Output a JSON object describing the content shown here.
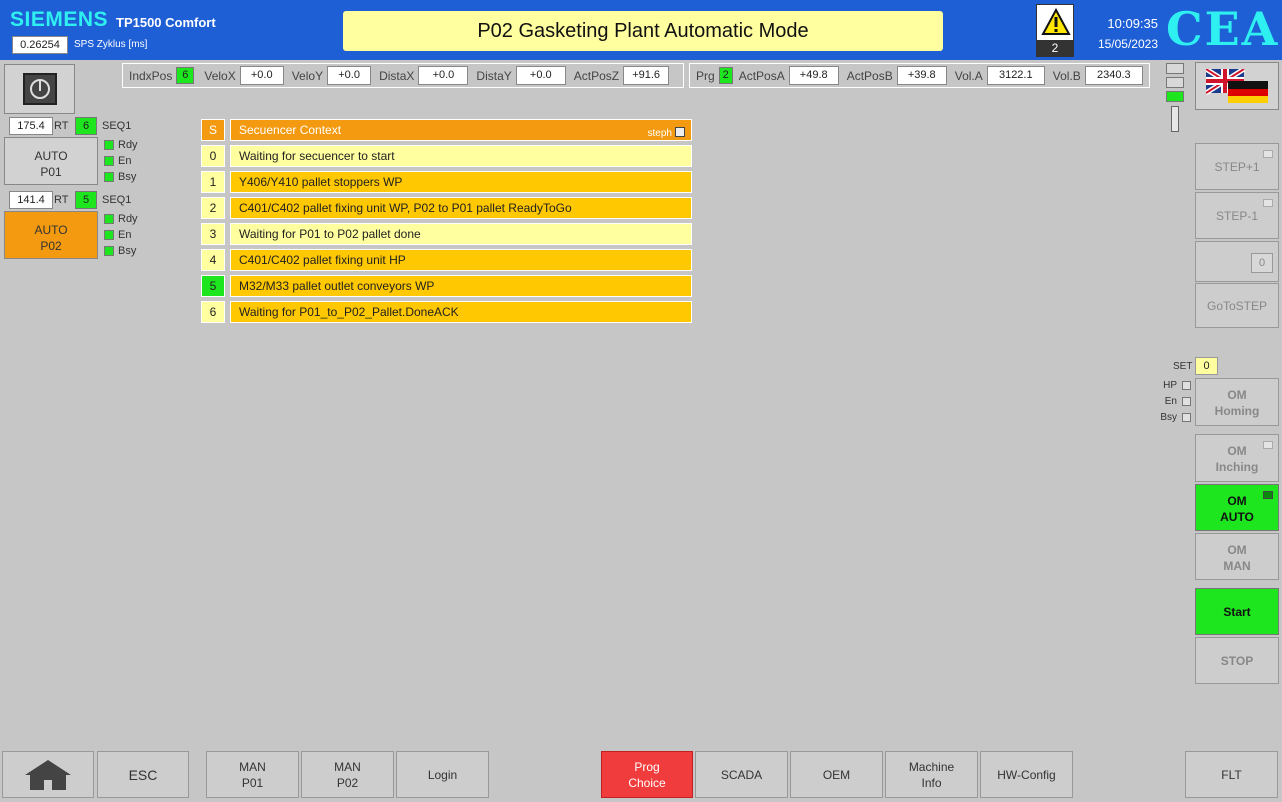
{
  "header": {
    "brand": "SIEMENS",
    "model": "TP1500 Comfort",
    "cycle_value": "0.26254",
    "cycle_label": "SPS Zyklus [ms]",
    "title": "P02 Gasketing Plant Automatic Mode",
    "alarm_count": "2",
    "time": "10:09:35",
    "date": "15/05/2023",
    "logo": "CEA"
  },
  "axis_left": {
    "indxpos_label": "IndxPos",
    "indxpos_value": "6",
    "velox_label": "VeloX",
    "velox_value": "+0.0",
    "veloy_label": "VeloY",
    "veloy_value": "+0.0",
    "distax_label": "DistaX",
    "distax_value": "+0.0",
    "distay_label": "DistaY",
    "distay_value": "+0.0",
    "actposz_label": "ActPosZ",
    "actposz_value": "+91.6"
  },
  "axis_right": {
    "prg_label": "Prg",
    "prg_value": "2",
    "actposa_label": "ActPosA",
    "actposa_value": "+49.8",
    "actposb_label": "ActPosB",
    "actposb_value": "+39.8",
    "vola_label": "Vol.A",
    "vola_value": "3122.1",
    "volb_label": "Vol.B",
    "volb_value": "2340.3"
  },
  "p01": {
    "rt_value": "175.4",
    "rt_label": "RT",
    "rt_num": "6",
    "seq_label": "SEQ1",
    "btn_line1": "AUTO",
    "btn_line2": "P01",
    "rdy": "Rdy",
    "en": "En",
    "bsy": "Bsy"
  },
  "p02": {
    "rt_value": "141.4",
    "rt_label": "RT",
    "rt_num": "5",
    "seq_label": "SEQ1",
    "btn_line1": "AUTO",
    "btn_line2": "P02",
    "rdy": "Rdy",
    "en": "En",
    "bsy": "Bsy"
  },
  "sequencer": {
    "header_num": "S",
    "header_text": "Secuencer Context",
    "steph_label": "steph",
    "steps": [
      {
        "num": "0",
        "text": "Waiting for secuencer to start"
      },
      {
        "num": "1",
        "text": "Y406/Y410 pallet stoppers WP"
      },
      {
        "num": "2",
        "text": "C401/C402 pallet fixing unit WP, P02 to P01 pallet ReadyToGo"
      },
      {
        "num": "3",
        "text": "Waiting for P01 to P02 pallet done"
      },
      {
        "num": "4",
        "text": "C401/C402 pallet fixing unit HP"
      },
      {
        "num": "5",
        "text": "M32/M33 pallet outlet conveyors WP"
      },
      {
        "num": "6",
        "text": "Waiting for P01_to_P02_Pallet.DoneACK"
      }
    ]
  },
  "right_panel": {
    "step_plus": "STEP+1",
    "step_minus": "STEP-1",
    "step_value": "0",
    "goto_step": "GoToSTEP",
    "set_label": "SET",
    "set_value": "0",
    "hp": "HP",
    "en": "En",
    "bsy": "Bsy",
    "om_homing_1": "OM",
    "om_homing_2": "Homing",
    "om_inching_1": "OM",
    "om_inching_2": "Inching",
    "om_auto_1": "OM",
    "om_auto_2": "AUTO",
    "om_man_1": "OM",
    "om_man_2": "MAN",
    "start": "Start",
    "stop": "STOP"
  },
  "bottom": {
    "esc": "ESC",
    "man_p01_1": "MAN",
    "man_p01_2": "P01",
    "man_p02_1": "MAN",
    "man_p02_2": "P02",
    "login": "Login",
    "prog_1": "Prog",
    "prog_2": "Choice",
    "scada": "SCADA",
    "oem": "OEM",
    "machine_1": "Machine",
    "machine_2": "Info",
    "hwconfig": "HW-Config",
    "flt": "FLT"
  },
  "colors": {
    "header_blue": "#1f5fd6",
    "brand_cyan": "#2ff0f0",
    "active_green": "#1ee61e",
    "seq_active": "#ffc800",
    "seq_idle": "#ffffa0",
    "seq_header": "#f39a10",
    "prog_red": "#f03c3c",
    "auto_p02_orange": "#f39a10"
  }
}
